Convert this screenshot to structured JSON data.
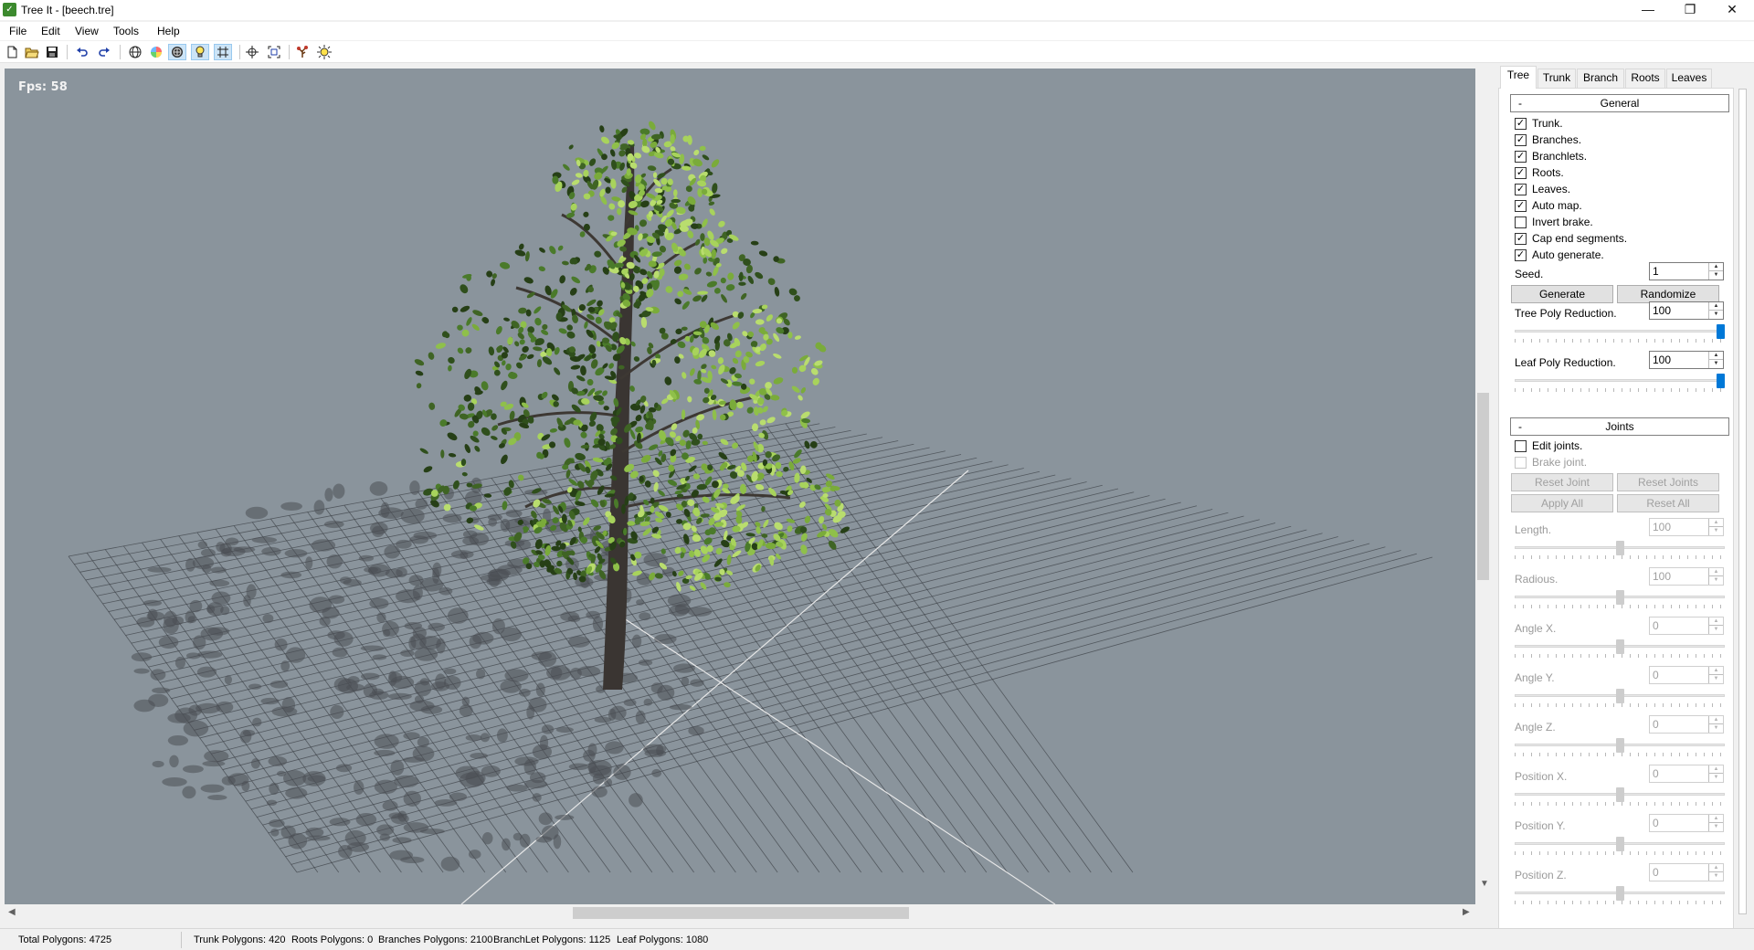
{
  "window": {
    "title": "Tree It - [beech.tre]",
    "icon": "tree-it-app-icon",
    "icon_glyph": "✓"
  },
  "window_controls": {
    "minimize": "—",
    "restore": "❐",
    "close": "✕"
  },
  "menu": [
    "File",
    "Edit",
    "View",
    "Tools",
    "Help"
  ],
  "toolbar": [
    {
      "name": "new-file-icon",
      "glyph": "🗋"
    },
    {
      "name": "open-folder-icon",
      "glyph": "📂"
    },
    {
      "name": "save-icon",
      "glyph": "💾"
    },
    {
      "name": "undo-icon",
      "glyph": "↶"
    },
    {
      "name": "redo-icon",
      "glyph": "↷"
    },
    {
      "name": "wireframe-sphere-icon",
      "glyph": "◍"
    },
    {
      "name": "color-sphere-icon",
      "glyph": "◕"
    },
    {
      "name": "textured-sphere-icon",
      "glyph": "◎"
    },
    {
      "name": "light-bulb-icon",
      "glyph": "💡"
    },
    {
      "name": "grid-icon",
      "glyph": "#"
    },
    {
      "name": "move-crosshair-icon",
      "glyph": "✜"
    },
    {
      "name": "zoom-fit-icon",
      "glyph": "⛶"
    },
    {
      "name": "tree-export-icon",
      "glyph": "♠"
    },
    {
      "name": "sun-settings-icon",
      "glyph": "☀"
    }
  ],
  "viewport": {
    "fps_text": "Fps: 58",
    "background_color": "#8a949c",
    "grid_color": "#3a3f44",
    "axis_color": "#e8e8e8"
  },
  "tabs": [
    "Tree",
    "Trunk",
    "Branch",
    "Roots",
    "Leaves"
  ],
  "active_tab": "Tree",
  "general": {
    "title": "General",
    "collapse": "-",
    "checkboxes": [
      {
        "label": "Trunk.",
        "checked": true
      },
      {
        "label": "Branches.",
        "checked": true
      },
      {
        "label": "Branchlets.",
        "checked": true
      },
      {
        "label": "Roots.",
        "checked": true
      },
      {
        "label": "Leaves.",
        "checked": true
      },
      {
        "label": "Auto map.",
        "checked": true
      },
      {
        "label": "Invert brake.",
        "checked": false
      },
      {
        "label": "Cap end segments.",
        "checked": true
      },
      {
        "label": "Auto generate.",
        "checked": true
      }
    ],
    "seed_label": "Seed.",
    "seed_value": "1",
    "generate_label": "Generate",
    "randomize_label": "Randomize",
    "tree_poly_label": "Tree Poly Reduction.",
    "tree_poly_value": "100",
    "tree_poly_fraction": 1.0,
    "leaf_poly_label": "Leaf Poly Reduction.",
    "leaf_poly_value": "100",
    "leaf_poly_fraction": 1.0
  },
  "joints": {
    "title": "Joints",
    "collapse": "-",
    "edit_joints_label": "Edit joints.",
    "edit_joints_checked": false,
    "brake_joint_label": "Brake joint.",
    "brake_joint_checked": false,
    "reset_joint_label": "Reset Joint",
    "reset_joints_label": "Reset Joints",
    "apply_all_label": "Apply All",
    "reset_all_label": "Reset All",
    "fields": [
      {
        "label": "Length.",
        "value": "100",
        "fraction": 0.5
      },
      {
        "label": "Radious.",
        "value": "100",
        "fraction": 0.5
      },
      {
        "label": "Angle X.",
        "value": "0",
        "fraction": 0.5
      },
      {
        "label": "Angle Y.",
        "value": "0",
        "fraction": 0.5
      },
      {
        "label": "Angle Z.",
        "value": "0",
        "fraction": 0.5
      },
      {
        "label": "Position X.",
        "value": "0",
        "fraction": 0.5
      },
      {
        "label": "Position Y.",
        "value": "0",
        "fraction": 0.5
      },
      {
        "label": "Position Z.",
        "value": "0",
        "fraction": 0.5
      }
    ]
  },
  "status": {
    "total": "Total Polygons: 4725",
    "trunk": "Trunk Polygons: 420",
    "roots": "Roots Polygons: 0",
    "branches": "Branches Polygons: 2100",
    "branchlet": "BranchLet Polygons: 1125",
    "leaf": "Leaf Polygons: 1080"
  }
}
